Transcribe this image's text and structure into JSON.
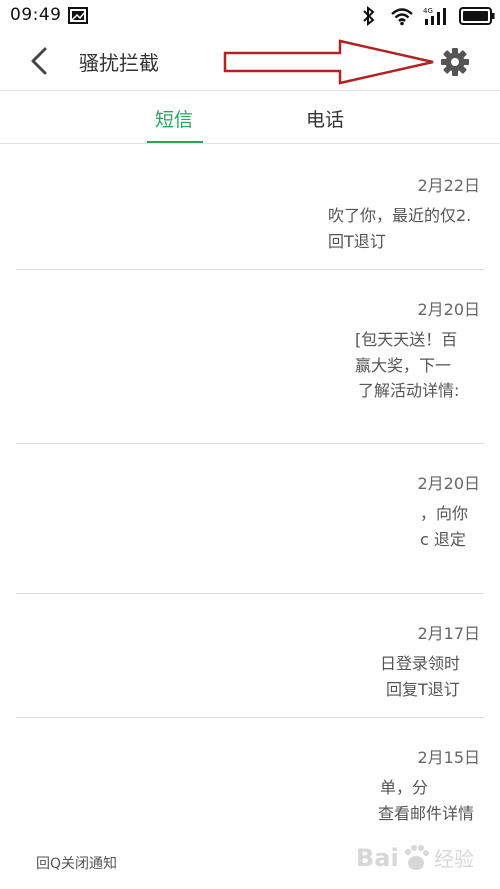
{
  "status_bar": {
    "time": "09:49",
    "icons": [
      "image-notification-icon",
      "bluetooth-icon",
      "wifi-icon",
      "4g-signal-icon",
      "battery-icon"
    ],
    "network_label": "4G"
  },
  "app_bar": {
    "title": "骚扰拦截",
    "back_icon": "chevron-left-icon",
    "settings_icon": "gear-icon"
  },
  "tabs": [
    {
      "label": "短信",
      "active": true
    },
    {
      "label": "电话",
      "active": false
    }
  ],
  "accent_color": "#31a05a",
  "annotation_color": "#b22222",
  "messages": [
    {
      "date": "2月22日",
      "lines": [
        "吹了你，最近的仅2.",
        "回T退订"
      ]
    },
    {
      "date": "2月20日",
      "lines": [
        "[包天天送！百",
        "赢大奖，下一",
        "了解活动详情:"
      ]
    },
    {
      "date": "2月20日",
      "lines": [
        "，向你",
        "c 退定"
      ]
    },
    {
      "date": "2月17日",
      "lines": [
        "日登录领时",
        "回复T退订"
      ]
    },
    {
      "date": "2月15日",
      "lines": [
        "单，分",
        "查看邮件详情"
      ]
    }
  ],
  "truncated_line": "回Q关闭通知",
  "watermark": "Bai 经验"
}
